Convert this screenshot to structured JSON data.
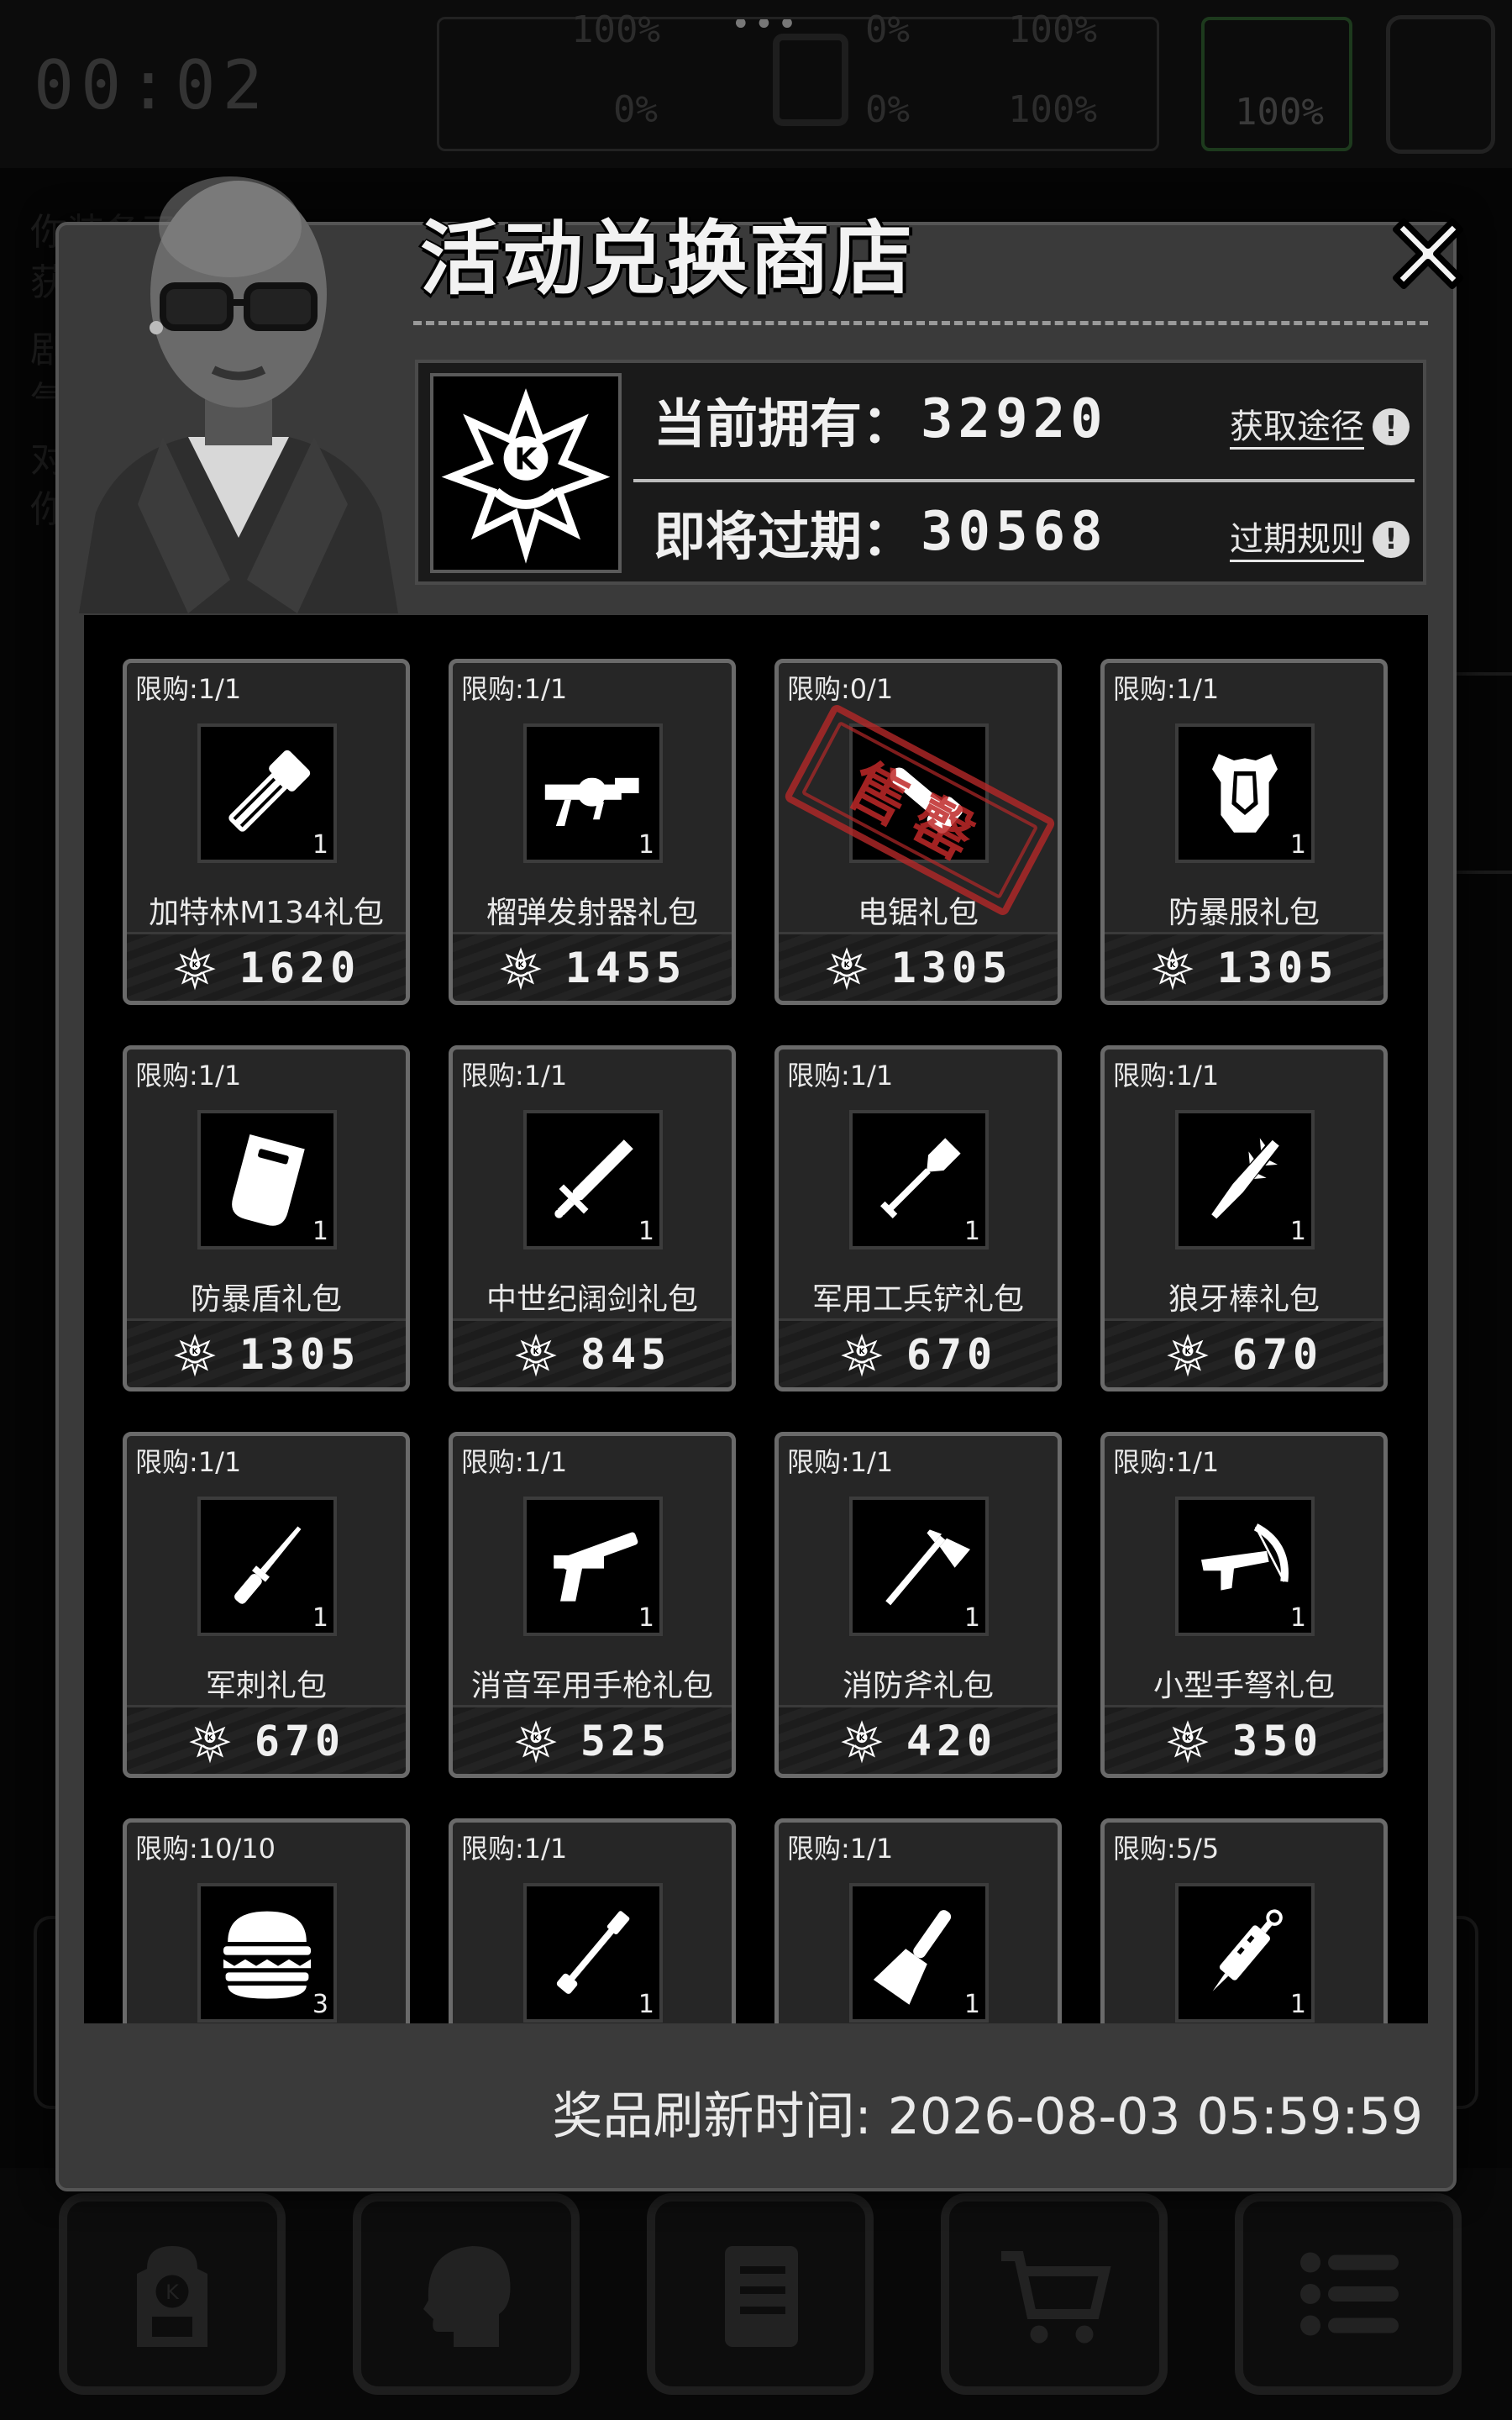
{
  "hud": {
    "timer": "00:02",
    "stat_top_1": "100%",
    "stat_bottom_1": "0%",
    "stat_top_2": "0%",
    "stat_bottom_2": "0%",
    "stat_top_3": "100%",
    "stat_bottom_3": "100%",
    "flag_stat": "100%"
  },
  "background_text": {
    "line1": "你装备了",
    "line2": "获",
    "line3": "剧",
    "line4": "气",
    "line5": "对",
    "line6": "你"
  },
  "shop": {
    "title": "活动兑换商店",
    "currency_icon": "k-emblem-icon",
    "owned_label": "当前拥有：",
    "owned_value": "32920",
    "expiring_label": "即将过期：",
    "expiring_value": "30568",
    "get_link": "获取途径",
    "expire_rule_link": "过期规则",
    "sold_out_stamp": "售罄",
    "refresh_label": "奖品刷新时间:",
    "refresh_time": "2026-08-03 05:59:59",
    "items": [
      {
        "limit": "限购:1/1",
        "name": "加特林M134礼包",
        "price": "1620",
        "qty": "1",
        "icon": "gatling-icon",
        "sold_out": false
      },
      {
        "limit": "限购:1/1",
        "name": "榴弹发射器礼包",
        "price": "1455",
        "qty": "1",
        "icon": "grenade-launcher-icon",
        "sold_out": false
      },
      {
        "limit": "限购:0/1",
        "name": "电锯礼包",
        "price": "1305",
        "qty": "",
        "icon": "chainsaw-icon",
        "sold_out": true
      },
      {
        "limit": "限购:1/1",
        "name": "防暴服礼包",
        "price": "1305",
        "qty": "1",
        "icon": "riot-armor-icon",
        "sold_out": false
      },
      {
        "limit": "限购:1/1",
        "name": "防暴盾礼包",
        "price": "1305",
        "qty": "1",
        "icon": "riot-shield-icon",
        "sold_out": false
      },
      {
        "limit": "限购:1/1",
        "name": "中世纪阔剑礼包",
        "price": "845",
        "qty": "1",
        "icon": "broadsword-icon",
        "sold_out": false
      },
      {
        "limit": "限购:1/1",
        "name": "军用工兵铲礼包",
        "price": "670",
        "qty": "1",
        "icon": "shovel-icon",
        "sold_out": false
      },
      {
        "limit": "限购:1/1",
        "name": "狼牙棒礼包",
        "price": "670",
        "qty": "1",
        "icon": "spiked-club-icon",
        "sold_out": false
      },
      {
        "limit": "限购:1/1",
        "name": "军刺礼包",
        "price": "670",
        "qty": "1",
        "icon": "bayonet-icon",
        "sold_out": false
      },
      {
        "limit": "限购:1/1",
        "name": "消音军用手枪礼包",
        "price": "525",
        "qty": "1",
        "icon": "silenced-pistol-icon",
        "sold_out": false
      },
      {
        "limit": "限购:1/1",
        "name": "消防斧礼包",
        "price": "420",
        "qty": "1",
        "icon": "fire-axe-icon",
        "sold_out": false
      },
      {
        "limit": "限购:1/1",
        "name": "小型手弩礼包",
        "price": "350",
        "qty": "1",
        "icon": "crossbow-icon",
        "sold_out": false
      },
      {
        "limit": "限购:10/10",
        "name": "",
        "price": "",
        "qty": "3",
        "icon": "burger-icon",
        "sold_out": false
      },
      {
        "limit": "限购:1/1",
        "name": "",
        "price": "",
        "qty": "1",
        "icon": "wrench-icon",
        "sold_out": false
      },
      {
        "limit": "限购:1/1",
        "name": "",
        "price": "",
        "qty": "1",
        "icon": "scraper-icon",
        "sold_out": false
      },
      {
        "limit": "限购:5/5",
        "name": "",
        "price": "",
        "qty": "1",
        "icon": "syringe-icon",
        "sold_out": false
      }
    ]
  },
  "bottom_nav": [
    {
      "icon": "backpack-icon"
    },
    {
      "icon": "brain-head-icon"
    },
    {
      "icon": "notebook-icon"
    },
    {
      "icon": "shopping-cart-icon"
    },
    {
      "icon": "menu-list-icon"
    }
  ]
}
